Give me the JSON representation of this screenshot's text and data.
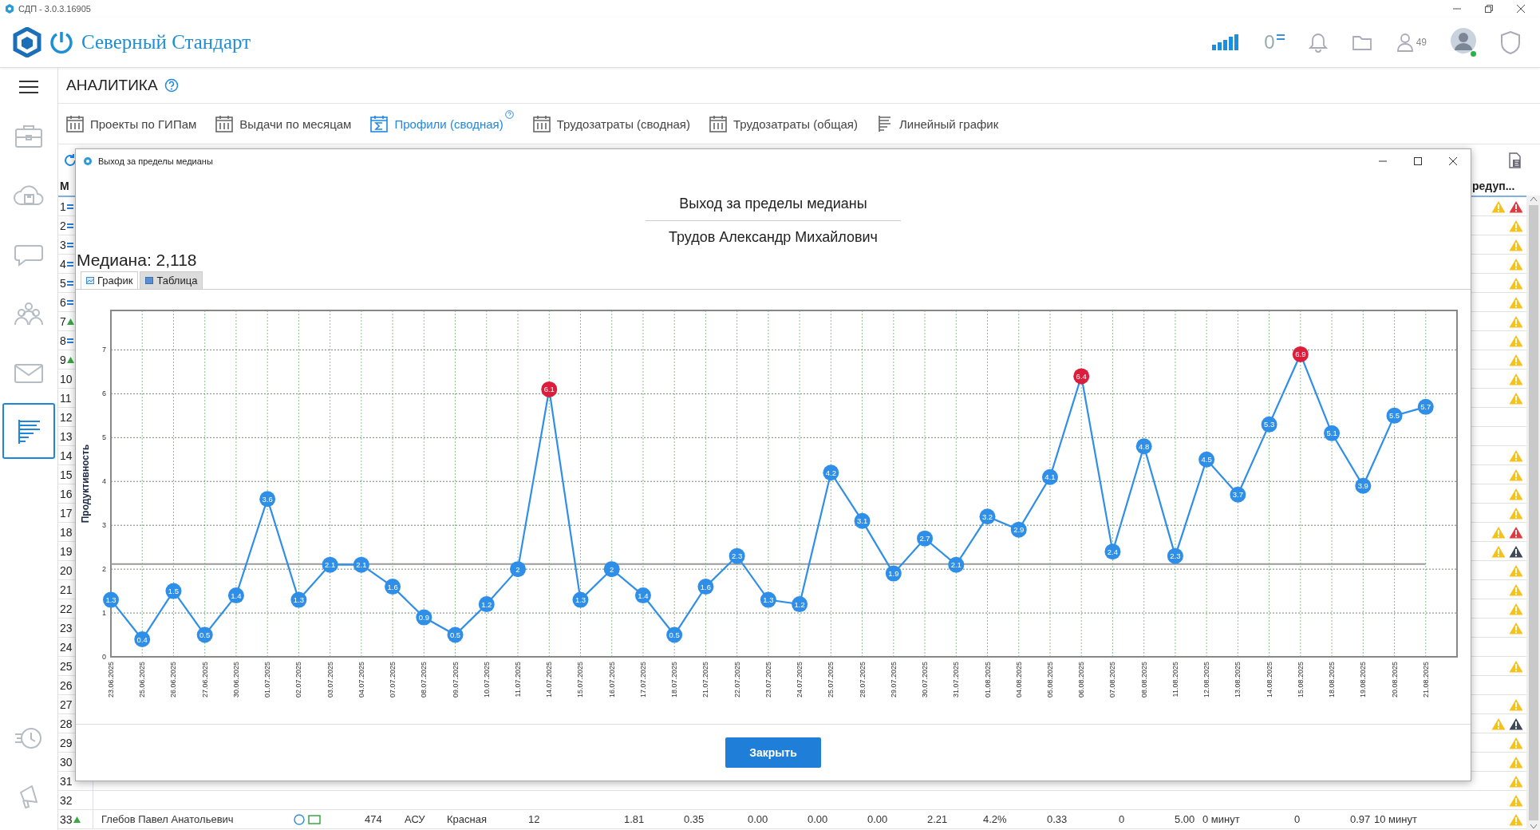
{
  "window": {
    "title": "СДП - 3.0.3.16905"
  },
  "header": {
    "brand": "Северный Стандарт",
    "counter": "0",
    "users_count": "49"
  },
  "section": {
    "title": "АНАЛИТИКА"
  },
  "tabs": [
    {
      "label": "Проекты по ГИПам",
      "kind": "calendar",
      "selected": false
    },
    {
      "label": "Выдачи по месяцам",
      "kind": "calendar",
      "selected": false
    },
    {
      "label": "Профили (сводная)",
      "kind": "sum",
      "selected": true
    },
    {
      "label": "Трудозатраты (сводная)",
      "kind": "calendar",
      "selected": false
    },
    {
      "label": "Трудозатраты (общая)",
      "kind": "calendar",
      "selected": false
    },
    {
      "label": "Линейный график",
      "kind": "list",
      "selected": false
    }
  ],
  "sidebar": {
    "items": [
      {
        "kind": "briefcase",
        "selected": false
      },
      {
        "kind": "cloud",
        "selected": false
      },
      {
        "kind": "chat",
        "selected": false
      },
      {
        "kind": "people",
        "selected": false
      },
      {
        "kind": "mail",
        "selected": false
      },
      {
        "kind": "report",
        "selected": true
      }
    ],
    "bottom_items": [
      {
        "kind": "history"
      },
      {
        "kind": "pin"
      }
    ]
  },
  "table": {
    "columns": [
      "М",
      "редуп..."
    ],
    "rows": [
      {
        "number": "1",
        "marker": {
          "kind": "equals"
        },
        "warnings": [
          {
            "kind": "warning"
          },
          {
            "kind": "error"
          }
        ]
      },
      {
        "number": "2",
        "marker": {
          "kind": "equals"
        },
        "warnings": [
          {
            "kind": "warning"
          }
        ]
      },
      {
        "number": "3",
        "marker": {
          "kind": "equals"
        },
        "warnings": [
          {
            "kind": "warning"
          }
        ]
      },
      {
        "number": "4",
        "marker": {
          "kind": "equals"
        },
        "warnings": [
          {
            "kind": "warning"
          }
        ]
      },
      {
        "number": "5",
        "marker": {
          "kind": "equals"
        },
        "warnings": [
          {
            "kind": "warning"
          }
        ]
      },
      {
        "number": "6",
        "marker": {
          "kind": "equals"
        },
        "warnings": [
          {
            "kind": "warning"
          }
        ]
      },
      {
        "number": "7",
        "marker": {
          "kind": "up"
        },
        "warnings": [
          {
            "kind": "warning"
          }
        ]
      },
      {
        "number": "8",
        "marker": {
          "kind": "equals"
        },
        "warnings": [
          {
            "kind": "warning"
          }
        ]
      },
      {
        "number": "9",
        "marker": {
          "kind": "up"
        },
        "warnings": [
          {
            "kind": "warning"
          }
        ]
      },
      {
        "number": "10",
        "warnings": [
          {
            "kind": "warning"
          }
        ]
      },
      {
        "number": "11",
        "warnings": [
          {
            "kind": "warning"
          }
        ]
      },
      {
        "number": "12"
      },
      {
        "number": "13"
      },
      {
        "number": "14",
        "warnings": [
          {
            "kind": "warning"
          }
        ]
      },
      {
        "number": "15",
        "warnings": [
          {
            "kind": "warning"
          }
        ]
      },
      {
        "number": "16",
        "warnings": [
          {
            "kind": "warning"
          }
        ]
      },
      {
        "number": "17",
        "warnings": [
          {
            "kind": "warning"
          }
        ]
      },
      {
        "number": "18",
        "warnings": [
          {
            "kind": "warning"
          },
          {
            "kind": "error"
          }
        ]
      },
      {
        "number": "19",
        "warnings": [
          {
            "kind": "warning"
          },
          {
            "kind": "critical"
          }
        ]
      },
      {
        "number": "20",
        "warnings": [
          {
            "kind": "warning"
          }
        ]
      },
      {
        "number": "21",
        "warnings": [
          {
            "kind": "warning"
          }
        ]
      },
      {
        "number": "22",
        "warnings": [
          {
            "kind": "warning"
          }
        ]
      },
      {
        "number": "23",
        "warnings": [
          {
            "kind": "warning"
          }
        ]
      },
      {
        "number": "24"
      },
      {
        "number": "25",
        "warnings": [
          {
            "kind": "warning"
          }
        ]
      },
      {
        "number": "26"
      },
      {
        "number": "27",
        "warnings": [
          {
            "kind": "warning"
          }
        ]
      },
      {
        "number": "28",
        "warnings": [
          {
            "kind": "warning"
          },
          {
            "kind": "critical"
          }
        ]
      },
      {
        "number": "29",
        "warnings": [
          {
            "kind": "warning"
          }
        ]
      },
      {
        "number": "30",
        "warnings": [
          {
            "kind": "warning"
          }
        ]
      },
      {
        "number": "31",
        "warnings": [
          {
            "kind": "warning"
          }
        ]
      },
      {
        "number": "32",
        "warnings": [
          {
            "kind": "warning"
          }
        ]
      },
      {
        "number": "33",
        "marker": {
          "kind": "up"
        },
        "cells": [
          "Глебов Павел Анатольевич",
          "474",
          "АСУ",
          "Красная",
          "12",
          "1.81",
          "0.35",
          "0.00",
          "0.00",
          "0.00",
          "2.21",
          "4.2%",
          "0.33",
          "0",
          "5.00",
          "0 минут",
          "0",
          "0.97",
          "10 минут"
        ],
        "warnings": [
          {
            "kind": "warning"
          }
        ]
      }
    ]
  },
  "dialog": {
    "title": "Выход за пределы медианы",
    "heading": "Выход за пределы медианы",
    "person": "Трудов Александр Михайлович",
    "median": "Медиана: 2,118",
    "tabs": [
      {
        "label": "График",
        "kind": "chart",
        "selected": true
      },
      {
        "label": "Таблица",
        "kind": "table",
        "selected": false
      }
    ],
    "chart_data": {
      "type": "line",
      "ylabel": "Продуктивность",
      "categories": [
        "23.06.2025",
        "25.06.2025",
        "26.06.2025",
        "27.06.2025",
        "30.06.2025",
        "01.07.2025",
        "02.07.2025",
        "03.07.2025",
        "04.07.2025",
        "07.07.2025",
        "08.07.2025",
        "09.07.2025",
        "10.07.2025",
        "11.07.2025",
        "14.07.2025",
        "15.07.2025",
        "16.07.2025",
        "17.07.2025",
        "18.07.2025",
        "21.07.2025",
        "22.07.2025",
        "23.07.2025",
        "24.07.2025",
        "25.07.2025",
        "28.07.2025",
        "29.07.2025",
        "30.07.2025",
        "31.07.2025",
        "01.08.2025",
        "04.08.2025",
        "05.08.2025",
        "06.08.2025",
        "07.08.2025",
        "08.08.2025",
        "11.08.2025",
        "12.08.2025",
        "13.08.2025",
        "14.08.2025",
        "15.08.2025",
        "18.08.2025",
        "19.08.2025",
        "20.08.2025",
        "21.08.2025"
      ],
      "series": [
        {
          "color": "#2f8fe8",
          "marker": "circle",
          "values": [
            1.3,
            0.4,
            1.5,
            0.5,
            1.4,
            3.6,
            1.3,
            2.1,
            2.1,
            1.6,
            0.9,
            0.5,
            1.2,
            2,
            6.1,
            1.3,
            2,
            1.4,
            0.5,
            1.6,
            2.3,
            1.3,
            1.2,
            4.2,
            3.1,
            1.9,
            2.7,
            2.1,
            3.2,
            2.9,
            4.1,
            6.4,
            2.4,
            4.8,
            2.3,
            4.5,
            3.7,
            5.3,
            6.9,
            5.1,
            3.9,
            5.5,
            5.7
          ]
        },
        {
          "type": "scatter",
          "color": "#dc1e3c",
          "marker": "circle",
          "values": [
            null,
            null,
            null,
            null,
            null,
            null,
            null,
            null,
            null,
            null,
            null,
            null,
            null,
            null,
            6.1,
            null,
            null,
            null,
            null,
            null,
            null,
            null,
            null,
            null,
            null,
            null,
            null,
            null,
            null,
            null,
            null,
            6.4,
            null,
            null,
            null,
            null,
            null,
            null,
            6.9,
            null,
            null,
            null,
            null
          ]
        }
      ],
      "ylim": [
        0,
        7.9
      ],
      "yticks": [
        0,
        1,
        2,
        3,
        4,
        5,
        6,
        7
      ],
      "grid": true,
      "value_labels": [
        [
          "1.3",
          "0.4",
          "1.5",
          "0.5",
          "1.4",
          "3.6",
          "1.3",
          "2.1",
          "2.1",
          "1.6",
          "0.9",
          "0.5",
          "1.2",
          "2",
          null,
          "1.3",
          "2",
          "1.4",
          "0.5",
          "1.6",
          "2.3",
          "1.3",
          "1.2",
          "4.2",
          "3.1",
          "1.9",
          "2.7",
          "2.1",
          "3.2",
          "2.9",
          "4.1",
          null,
          "2.4",
          "4.8",
          "2.3",
          "4.5",
          "3.7",
          "5.3",
          null,
          "5.1",
          "3.9",
          "5.5",
          "5.7"
        ],
        [
          null,
          null,
          null,
          null,
          null,
          null,
          null,
          null,
          null,
          null,
          null,
          null,
          null,
          null,
          "6.1",
          null,
          null,
          null,
          null,
          null,
          null,
          null,
          null,
          null,
          null,
          null,
          null,
          null,
          null,
          null,
          null,
          "6.4",
          null,
          null,
          null,
          null,
          null,
          null,
          "6.9",
          null,
          null,
          null,
          null
        ]
      ],
      "ref_lines": [
        {
          "axis": "y",
          "value": 2.118,
          "color": "#9a9a9a"
        }
      ]
    },
    "close_button": "Закрыть"
  }
}
